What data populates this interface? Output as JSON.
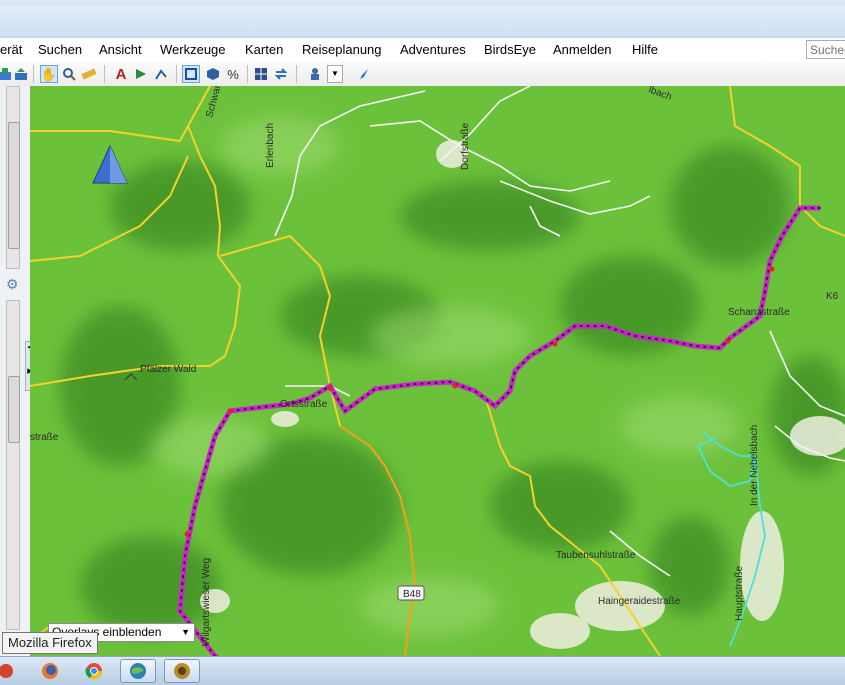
{
  "menu": {
    "items": [
      {
        "label": "erät"
      },
      {
        "label": "Suchen"
      },
      {
        "label": "Ansicht"
      },
      {
        "label": "Werkzeuge"
      },
      {
        "label": "Karten"
      },
      {
        "label": "Reiseplanung"
      },
      {
        "label": "Adventures"
      },
      {
        "label": "BirdsEye"
      },
      {
        "label": "Anmelden"
      },
      {
        "label": "Hilfe"
      }
    ]
  },
  "search": {
    "placeholder": "Suchen"
  },
  "map": {
    "labels": {
      "schwarz": "Schwarz",
      "erlenbach": "Erlenbach",
      "dorfstrasse": "Dorfstraße",
      "lbach": "lbach",
      "pfalzer_wald": "Pfälzer Wald",
      "ortsstrasse": "Ortsstraße",
      "schanzstrasse": "Schanzstraße",
      "k6": "K6",
      "in_der_nebelsbach": "In der Nebelsbach",
      "taubensuhlstrasse": "Taubensuhlstraße",
      "haingeraidestrasse": "Haingeraidestraße",
      "hauptstrasse": "Hauptstraße",
      "wilgartswieser_weg": "Wilgartswieser Weg",
      "b48": "B48",
      "strasse_left": "straße"
    }
  },
  "overlay": {
    "select_value": "Overlays einblenden"
  },
  "tooltip": {
    "text": "Mozilla Firefox"
  },
  "colors": {
    "map_green": "#6cc13b",
    "track_magenta": "#c826c8",
    "road_yellow": "#f2d22c",
    "road_orange": "#e9a21f"
  }
}
